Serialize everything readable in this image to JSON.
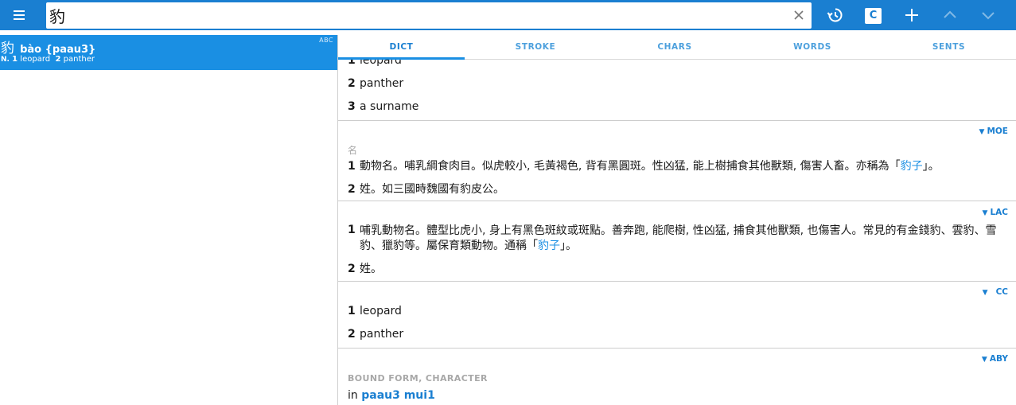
{
  "search": {
    "value": "豹",
    "placeholder": ""
  },
  "toolbar": {
    "c_label": "C"
  },
  "results": [
    {
      "char": "豹",
      "pron": "bào {paau3}",
      "tag": "ABC",
      "pos": "N.",
      "defs": [
        {
          "n": "1",
          "t": "leopard"
        },
        {
          "n": "2",
          "t": "panther"
        }
      ]
    }
  ],
  "tabs": [
    "DICT",
    "STROKE",
    "CHARS",
    "WORDS",
    "SENTS"
  ],
  "sections": {
    "abc": {
      "defs": [
        {
          "n": "1",
          "t": "leopard"
        },
        {
          "n": "2",
          "t": "panther"
        },
        {
          "n": "3",
          "t": "a surname"
        }
      ]
    },
    "moe": {
      "tag": "MOE",
      "pos": "名",
      "def1_a": "動物名。哺乳綱食肉目。似虎較小, 毛黃褐色, 背有黑圓斑。性凶猛, 能上樹捕食其他獸類, 傷害人畜。亦稱為「",
      "def1_link": "豹子",
      "def1_b": "」。",
      "def2": "姓。如三國時魏國有豹皮公。"
    },
    "lac": {
      "tag": "LAC",
      "def1_a": "哺乳動物名。體型比虎小, 身上有黑色斑紋或斑點。善奔跑, 能爬樹, 性凶猛, 捕食其他獸類, 也傷害人。常見的有金錢豹、雲豹、雪豹、獵豹等。屬保育類動物。通稱「",
      "def1_link": "豹子",
      "def1_b": "」。",
      "def2": "姓。"
    },
    "cc": {
      "tag": "CC",
      "defs": [
        {
          "n": "1",
          "t": "leopard"
        },
        {
          "n": "2",
          "t": "panther"
        }
      ]
    },
    "aby": {
      "tag": "ABY",
      "label": "BOUND FORM, CHARACTER",
      "prefix": "in",
      "link": "paau3 mui1"
    }
  },
  "colors": {
    "accent": "#1a7fd1",
    "selected_row": "#1a8fe3"
  }
}
